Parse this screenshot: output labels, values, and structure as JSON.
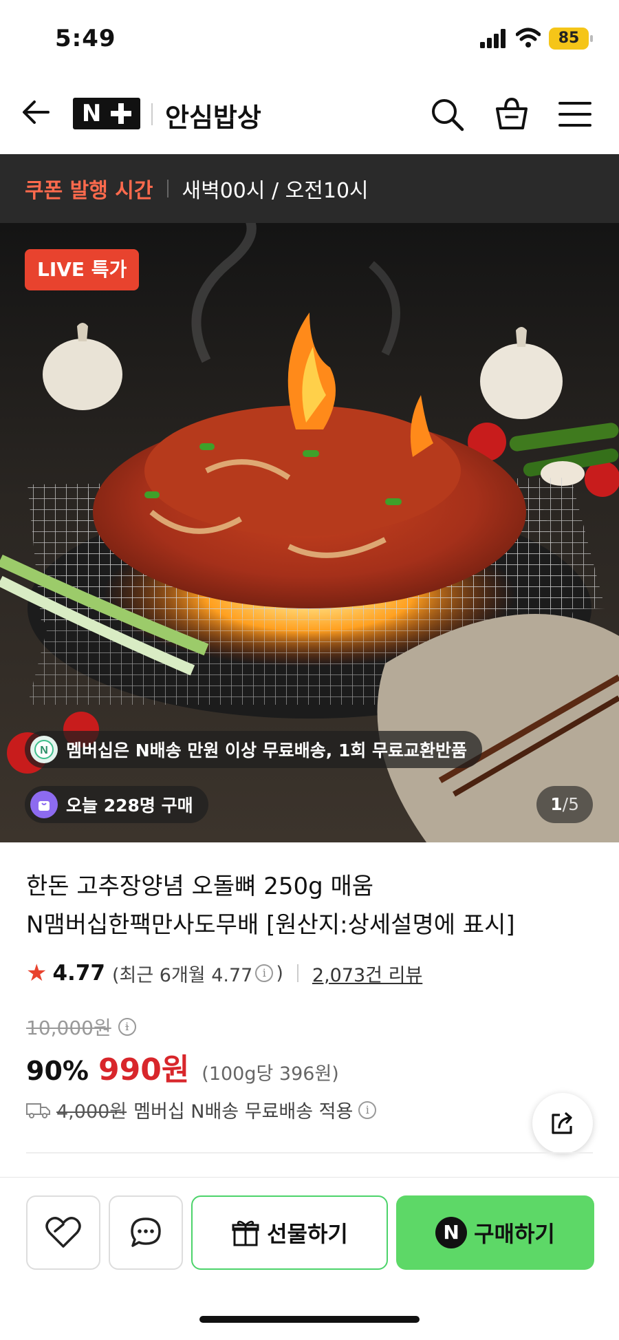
{
  "status_bar": {
    "time": "5:49",
    "battery": "85"
  },
  "header": {
    "brand_logo": "N",
    "brand": "안심밥상"
  },
  "coupon": {
    "label": "쿠폰 발행 시간",
    "value": "새벽00시 / 오전10시"
  },
  "hero": {
    "live_badge": "LIVE 특가",
    "membership_pill": "멤버십은 N배송 만원 이상 무료배송, 1회 무료교환반품",
    "purchases_pill": "오늘 228명 구매",
    "counter_current": "1",
    "counter_total": "/5"
  },
  "product": {
    "title_line1": "한돈 고추장양념 오돌뼈 250g 매움",
    "title_line2": "N맴버십한팩만사도무배 [원산지:상세설명에 표시]",
    "rating": "4.77",
    "rating_recent": "(최근 6개월 4.77",
    "rating_close": ")",
    "review_count": "2,073건 리뷰",
    "original_price": "10,000원",
    "discount": "90%",
    "price": "990원",
    "unit_price": "(100g당 396원)",
    "ship_original": "4,000원",
    "ship_text": "멤버십 N배송 무료배송 적용"
  },
  "actions": {
    "gift_label": "선물하기",
    "buy_label": "구매하기",
    "buy_badge": "N"
  },
  "icons": [
    "back-arrow-icon",
    "search-icon",
    "shopping-bag-icon",
    "menu-icon",
    "heart-icon",
    "chat-icon",
    "gift-icon",
    "share-icon",
    "truck-icon",
    "star-icon",
    "info-icon"
  ]
}
